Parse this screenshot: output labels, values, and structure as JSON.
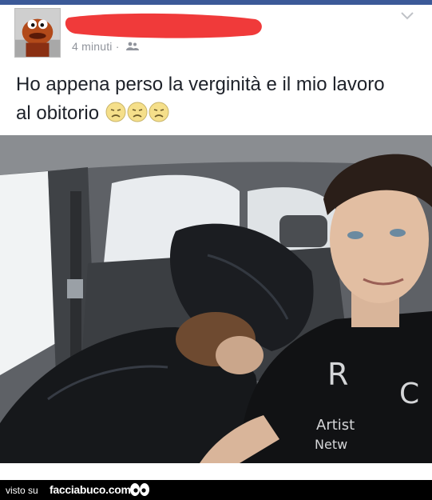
{
  "post": {
    "timestamp": "4 minuti",
    "separator": "·",
    "audience_icon": "friends-icon",
    "status_text": "Ho appena perso la verginità e il mio lavoro al obitorio",
    "emojis": [
      "sad-face-emoji",
      "sad-face-emoji",
      "sad-face-emoji"
    ]
  },
  "footer": {
    "prefix": "visto su",
    "site": "facciabuco.com",
    "logo_icon": "eyes-icon"
  },
  "colors": {
    "facebook_blue": "#3b5998",
    "redaction_red": "#f03a3a",
    "text": "#1d2129",
    "meta_gray": "#90949c"
  }
}
